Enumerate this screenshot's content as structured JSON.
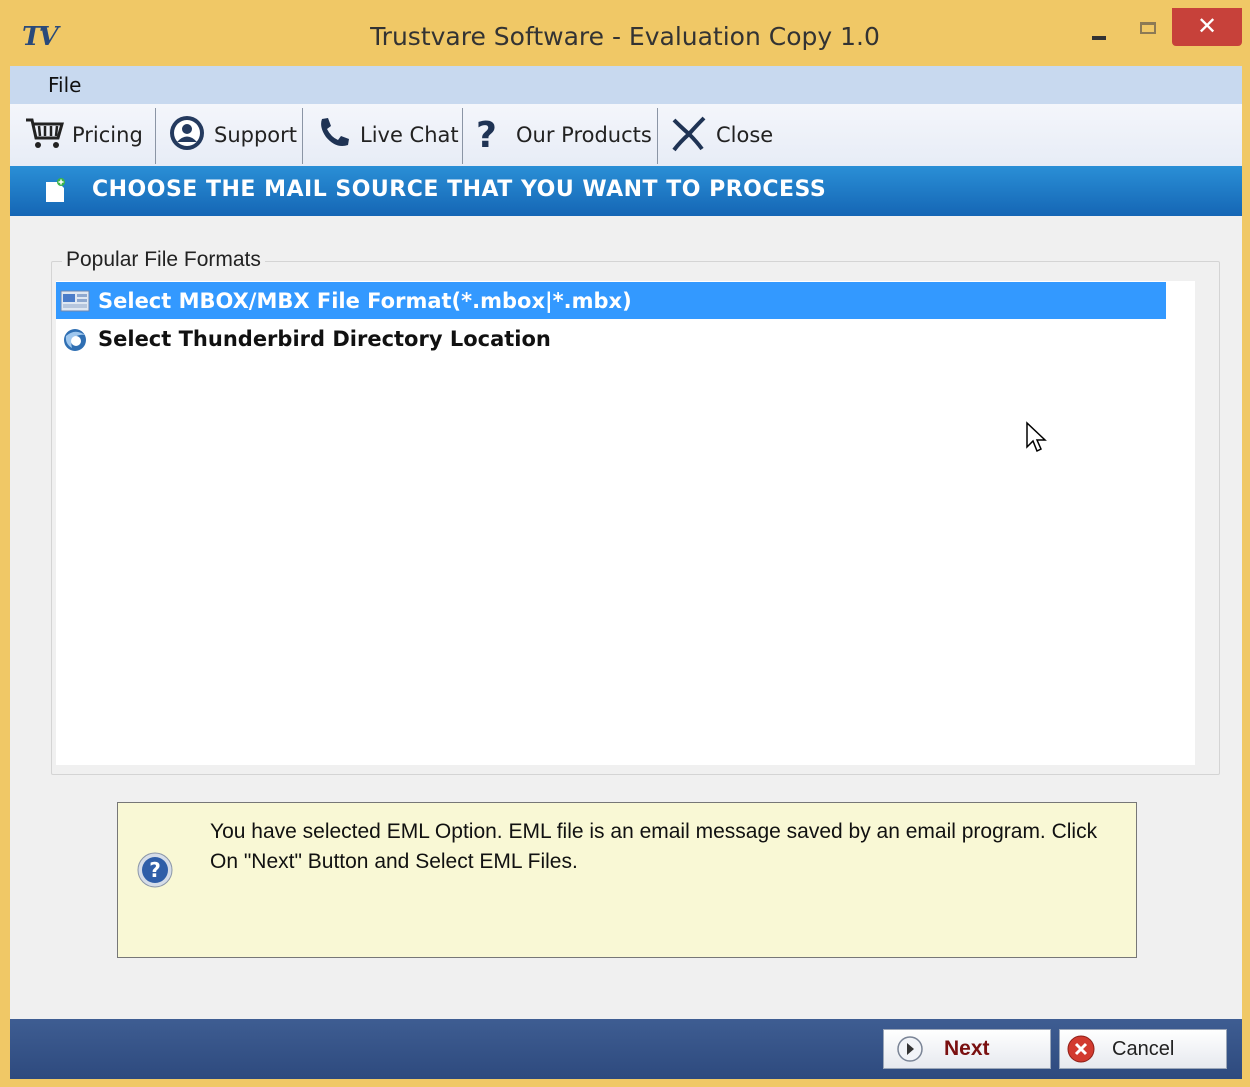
{
  "window": {
    "title": "Trustvare Software - Evaluation Copy 1.0",
    "logo_text": "TV",
    "close_glyph": "✕"
  },
  "menu": {
    "file_label": "File"
  },
  "toolbar": {
    "items": [
      {
        "label": "Pricing",
        "icon": "cart-icon"
      },
      {
        "label": "Support",
        "icon": "support-icon"
      },
      {
        "label": "Live Chat",
        "icon": "phone-icon"
      },
      {
        "label": "Our Products",
        "icon": "question-icon"
      },
      {
        "label": "Close",
        "icon": "close-x-icon"
      }
    ]
  },
  "banner": {
    "text": "CHOOSE THE MAIL SOURCE THAT YOU WANT TO PROCESS"
  },
  "formats": {
    "legend": "Popular File Formats",
    "items": [
      {
        "label": "Select MBOX/MBX File Format(*.mbox|*.mbx)",
        "selected": true,
        "icon": "mbox-file-icon"
      },
      {
        "label": "Select Thunderbird Directory Location",
        "selected": false,
        "icon": "thunderbird-icon"
      }
    ]
  },
  "info": {
    "text": "You have selected EML Option. EML file is an email message saved by an email program. Click On \"Next\" Button and Select EML Files."
  },
  "footer": {
    "next_label": "Next",
    "cancel_label": "Cancel"
  },
  "colors": {
    "title_bar": "#f0c866",
    "banner": "#1f7cc8",
    "selection": "#3399ff",
    "info_bg": "#f9f8d5",
    "footer": "#365489"
  }
}
